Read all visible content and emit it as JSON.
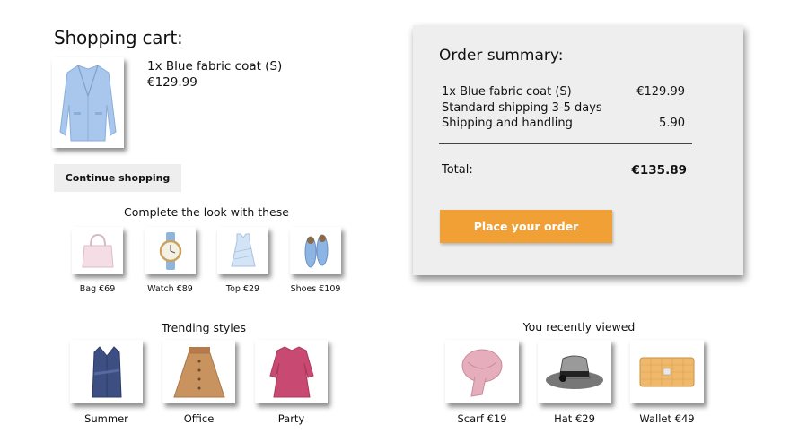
{
  "cart": {
    "title": "Shopping cart:",
    "item": {
      "name": "1x Blue fabric coat (S)",
      "price": "€129.99",
      "icon": "coat-image"
    },
    "continue_label": "Continue shopping"
  },
  "complete_look": {
    "title": "Complete the look with these",
    "items": [
      {
        "label": "Bag €69",
        "icon": "bag-image"
      },
      {
        "label": "Watch €89",
        "icon": "watch-image"
      },
      {
        "label": "Top €29",
        "icon": "top-image"
      },
      {
        "label": "Shoes €109",
        "icon": "shoes-image"
      }
    ]
  },
  "trending": {
    "title": "Trending styles",
    "items": [
      {
        "label": "Summer",
        "icon": "vest-image"
      },
      {
        "label": "Office",
        "icon": "skirt-image"
      },
      {
        "label": "Party",
        "icon": "dress-image"
      }
    ]
  },
  "recently_viewed": {
    "title": "You recently viewed",
    "items": [
      {
        "label": "Scarf €19",
        "icon": "scarf-image"
      },
      {
        "label": "Hat €29",
        "icon": "hat-image"
      },
      {
        "label": "Wallet €49",
        "icon": "wallet-image"
      }
    ]
  },
  "summary": {
    "title": "Order summary:",
    "lines": [
      {
        "label": "1x Blue fabric coat (S)",
        "amount": "€129.99"
      },
      {
        "label": "Standard shipping 3-5 days",
        "amount": ""
      },
      {
        "label": "Shipping and handling",
        "amount": "5.90"
      }
    ],
    "total_label": "Total:",
    "total_amount": "€135.89",
    "order_label": "Place your order"
  },
  "colors": {
    "accent": "#f0a035",
    "panel": "#eeeeee"
  }
}
